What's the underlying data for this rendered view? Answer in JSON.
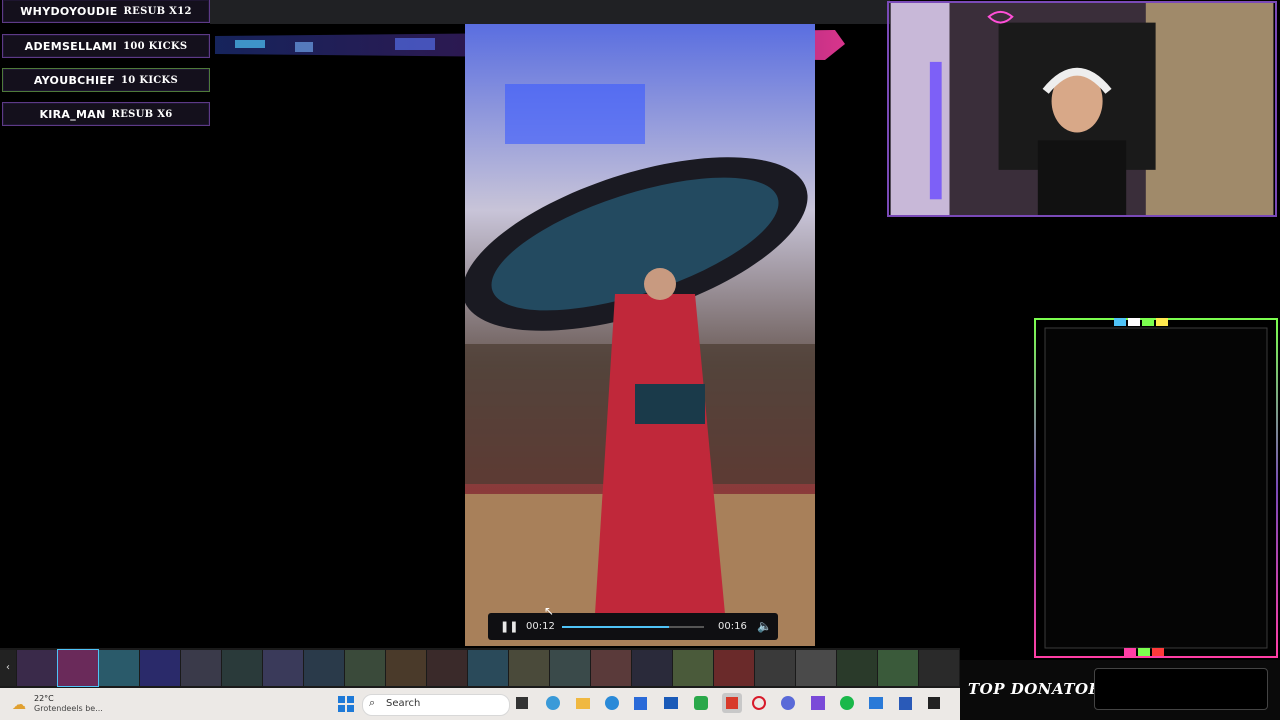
{
  "alerts": [
    {
      "name": "WHYDOYOUDIE",
      "detail": "RESUB X12"
    },
    {
      "name": "ADEMSELLAMI",
      "detail": "100 KICKS"
    },
    {
      "name": "AYOUBCHIEF",
      "detail": "10 KICKS"
    },
    {
      "name": "KIRA_MAN",
      "detail": "RESUB X6"
    }
  ],
  "player": {
    "current_time": "00:12",
    "duration": "00:16",
    "progress_fraction": 0.75,
    "state": "playing"
  },
  "taskbar": {
    "weather_temp": "22°C",
    "weather_desc": "Grotendeels be...",
    "search_label": "Search"
  },
  "overlay": {
    "top_donator_title": "TOP DONATOR"
  },
  "colors": {
    "accent_purple": "#7a4ab8",
    "accent_pink": "#ff3ea5",
    "accent_cyan": "#4fc3f7",
    "accent_green": "#7cff4f"
  }
}
